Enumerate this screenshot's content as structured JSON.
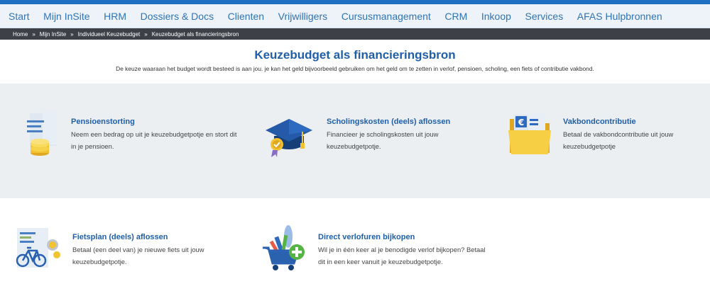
{
  "nav": {
    "items": [
      "Start",
      "Mijn InSite",
      "HRM",
      "Dossiers & Docs",
      "Clienten",
      "Vrijwilligers",
      "Cursusmanagement",
      "CRM",
      "Inkoop",
      "Services",
      "AFAS Hulpbronnen"
    ]
  },
  "breadcrumb": {
    "items": [
      "Home",
      "Mijn InSite",
      "Individueel Keuzebudget",
      "Keuzebudget als financieringsbron"
    ],
    "separator": "»"
  },
  "hero": {
    "title": "Keuzebudget als financieringsbron",
    "subtitle": "De keuze waaraan het budget wordt besteed is aan jou. je kan het geld bijvoorbeeld gebruiken om het geld om te zetten in verlof, pensioen, scholing, een fiets of contributie vakbond."
  },
  "cards": [
    {
      "title": "Pensioenstorting",
      "desc": "Neem een bedrag op uit je keuzebudgetpotje en stort dit in je pensioen.",
      "icon": "pension-coins-icon"
    },
    {
      "title": "Scholingskosten (deels) aflossen",
      "desc": "Financieer je scholingskosten uit jouw keuzebudgetpotje.",
      "icon": "graduation-cap-icon"
    },
    {
      "title": "Vakbondcontributie",
      "desc": "Betaal de vakbondcontributie uit jouw keuzebudgetpotje",
      "icon": "euro-folder-icon"
    },
    {
      "title": "Fietsplan (deels) aflossen",
      "desc": "Betaal (een deel van) je nieuwe fiets uit jouw keuzebudgetpotje.",
      "icon": "bicycle-icon"
    },
    {
      "title": "Direct verlofuren bijkopen",
      "desc": "Wil je in één keer al je benodigde verlof bijkopen? Betaal dit in een keer vanuit je keuzebudgetpotje.",
      "icon": "shopping-cart-plus-icon"
    }
  ],
  "colors": {
    "accent": "#1f5fa8",
    "nav_text": "#2f73b5",
    "breadcrumb_bg": "#3d4147",
    "band_bg": "#eceff2",
    "coin": "#f2c230",
    "folder": "#f7cf45",
    "plus_green": "#56b447"
  }
}
